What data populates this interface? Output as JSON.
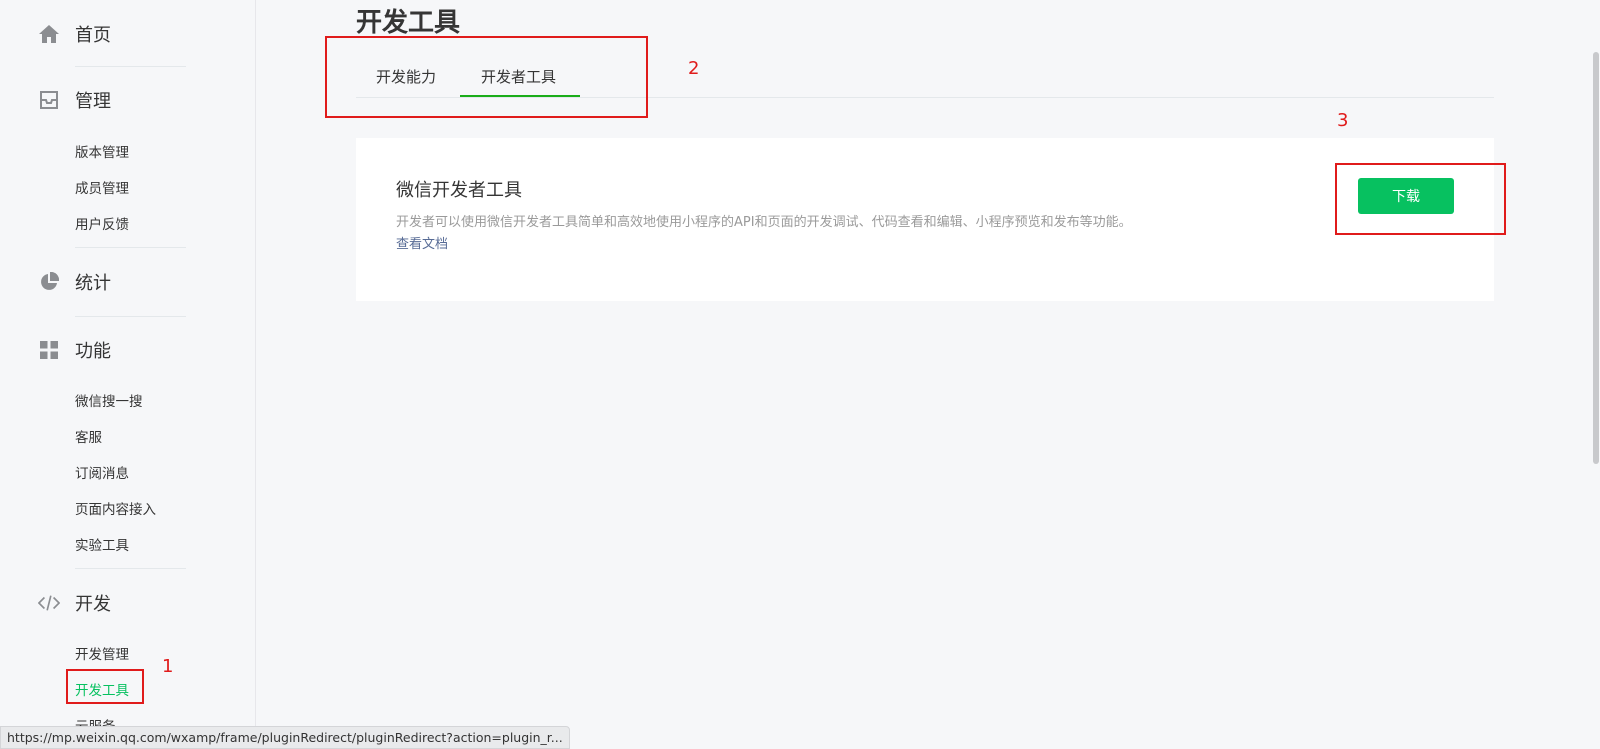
{
  "sidebar": {
    "home": {
      "label": "首页",
      "icon": "home-icon"
    },
    "manage": {
      "label": "管理",
      "icon": "inbox-icon",
      "items": [
        "版本管理",
        "成员管理",
        "用户反馈"
      ]
    },
    "stats": {
      "label": "统计",
      "icon": "pie-chart-icon"
    },
    "features": {
      "label": "功能",
      "icon": "grid-icon",
      "items": [
        "微信搜一搜",
        "客服",
        "订阅消息",
        "页面内容接入",
        "实验工具"
      ]
    },
    "dev": {
      "label": "开发",
      "icon": "code-icon",
      "items": [
        "开发管理",
        "开发工具",
        "云服务"
      ],
      "active_item": "开发工具"
    }
  },
  "main": {
    "title": "开发工具",
    "tabs": [
      {
        "label": "开发能力"
      },
      {
        "label": "开发者工具",
        "active": true
      }
    ],
    "card": {
      "title": "微信开发者工具",
      "description": "开发者可以使用微信开发者工具简单和高效地使用小程序的API和页面的开发调试、代码查看和编辑、小程序预览和发布等功能。",
      "link": "查看文档",
      "button": "下载"
    }
  },
  "annotations": [
    "1",
    "2",
    "3"
  ],
  "status_url": "https://mp.weixin.qq.com/wxamp/frame/pluginRedirect/pluginRedirect?action=plugin_r...",
  "colors": {
    "accent": "#07c160",
    "tab_underline": "#1aad19",
    "link": "#576b95",
    "annotation": "#e01b1b"
  }
}
